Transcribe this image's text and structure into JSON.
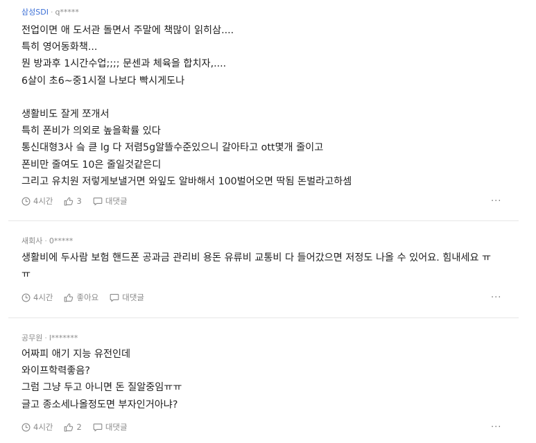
{
  "comments": [
    {
      "company": "삼성SDI",
      "author": "q*****",
      "lines": [
        "전업이면 애 도서관 돌면서 주말에 책많이 읽히삼....",
        "특히 영어동화책...",
        "뭔 방과후 1시간수업;;;; 문센과 체육을 합치자,....",
        "6살이 초6~중1시절 나보다 빡시게도나",
        "",
        "생활비도 잘게 쪼개서",
        "특히 폰비가 의외로 높을확률 있다",
        "통신대형3사 슼 큳 lg 다 저렴5g알뜰수준있으니 갈아타고 ott몇개 줄이고",
        "폰비만 줄여도 10은 줄일것같은디",
        "그리고 유치원 저렇게보낼거면 와잎도 알바해서 100벌어오면 딱됨 돈벌라고하셈"
      ],
      "time": "4시간",
      "likes": "3",
      "reply": "대댓글",
      "more": "···"
    },
    {
      "company": "새회사",
      "author": "0*****",
      "lines": [
        "생활비에 두사람 보험 핸드폰 공과금 관리비 용돈 유류비 교통비 다 들어갔으면 저정도 나올 수 있어요. 힘내세요 ㅠㅠ"
      ],
      "time": "4시간",
      "likes": "좋아요",
      "reply": "대댓글",
      "more": "···"
    },
    {
      "company": "공무원",
      "author": "l*******",
      "lines": [
        "어짜피 애기 지능 유전인데",
        "와이프학력좋음?",
        "그럼 그냥 두고 아니면 돈 질알중임ㅠㅠ",
        "글고 종소세나올정도면 부자인거아냐?"
      ],
      "time": "4시간",
      "likes": "2",
      "reply": "대댓글",
      "more": "···"
    }
  ],
  "colors": {
    "accent": "#3b6fd6",
    "meta": "#8a8a8a",
    "text": "#1f1f1f",
    "divider": "#e6e6e6"
  }
}
